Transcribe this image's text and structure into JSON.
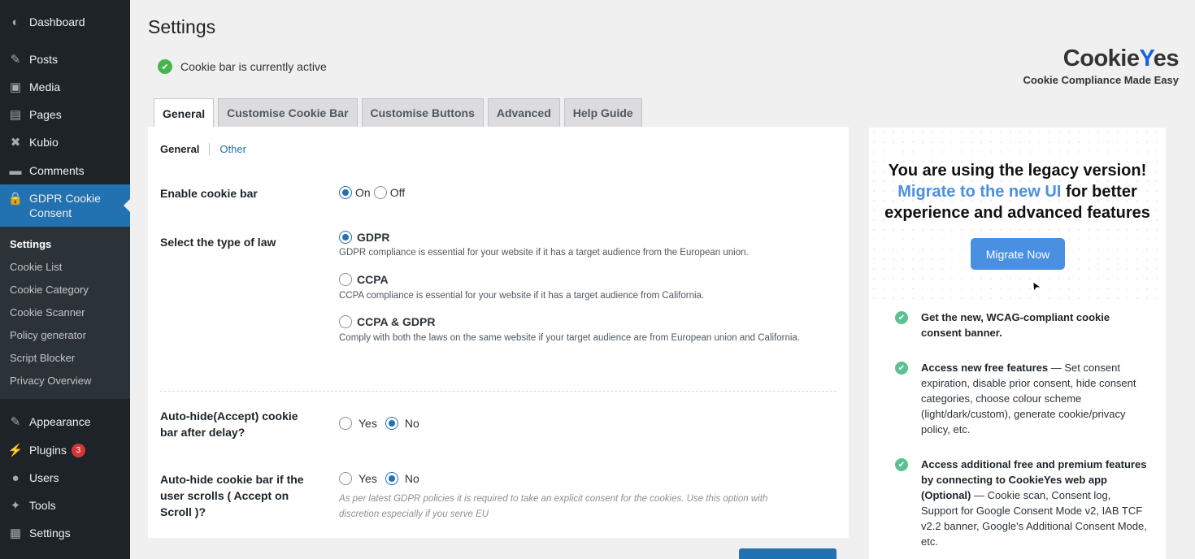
{
  "sidebar": {
    "menu": [
      {
        "label": "Dashboard",
        "icon": "dashboard-icon",
        "glyph": "◐"
      },
      {
        "label": "Posts",
        "icon": "pin-icon",
        "glyph": "✎"
      },
      {
        "label": "Media",
        "icon": "media-icon",
        "glyph": "▣"
      },
      {
        "label": "Pages",
        "icon": "pages-icon",
        "glyph": "▤"
      },
      {
        "label": "Kubio",
        "icon": "kubio-icon",
        "glyph": "✖"
      },
      {
        "label": "Comments",
        "icon": "comments-icon",
        "glyph": "▬"
      },
      {
        "label": "GDPR Cookie Consent",
        "icon": "lock-icon",
        "glyph": "🔒"
      },
      {
        "label": "Appearance",
        "icon": "brush-icon",
        "glyph": "✎"
      },
      {
        "label": "Plugins",
        "icon": "plugins-icon",
        "glyph": "⚡"
      },
      {
        "label": "Users",
        "icon": "user-icon",
        "glyph": "●"
      },
      {
        "label": "Tools",
        "icon": "wrench-icon",
        "glyph": "✦"
      },
      {
        "label": "Settings",
        "icon": "settings-icon",
        "glyph": "▦"
      }
    ],
    "plugins_badge": "3",
    "submenu": [
      "Settings",
      "Cookie List",
      "Cookie Category",
      "Cookie Scanner",
      "Policy generator",
      "Script Blocker",
      "Privacy Overview"
    ]
  },
  "page": {
    "title": "Settings",
    "status": "Cookie bar is currently active"
  },
  "logo": {
    "brand_a": "Cookie",
    "brand_y": "Y",
    "brand_b": "es",
    "tagline": "Cookie Compliance Made Easy"
  },
  "tabs": [
    "General",
    "Customise Cookie Bar",
    "Customise Buttons",
    "Advanced",
    "Help Guide"
  ],
  "subtabs": {
    "general": "General",
    "other": "Other"
  },
  "form": {
    "enable_label": "Enable cookie bar",
    "enable_on": "On",
    "enable_off": "Off",
    "law_label": "Select the type of law",
    "gdpr": "GDPR",
    "gdpr_desc": "GDPR compliance is essential for your website if it has a target audience from the European union.",
    "ccpa": "CCPA",
    "ccpa_desc": "CCPA compliance is essential for your website if it has a target audience from California.",
    "both": "CCPA & GDPR",
    "both_desc": "Comply with both the laws on the same website if your target audience are from European union and California.",
    "autohide_label": "Auto-hide(Accept) cookie bar after delay?",
    "yes": "Yes",
    "no": "No",
    "scroll_label": "Auto-hide cookie bar if the user scrolls ( Accept on Scroll )?",
    "scroll_desc": "As per latest GDPR policies it is required to take an explicit consent for the cookies. Use this option with discretion especially if you serve EU"
  },
  "promo": {
    "line1": "You are using the legacy version!",
    "link": "Migrate to the new UI",
    "line2": " for better",
    "line3": "experience and advanced features",
    "button": "Migrate Now",
    "f1_bold": "Get the new, WCAG-compliant cookie consent banner.",
    "f2_bold": "Access new free features",
    "f2_rest": " — Set consent expiration, disable prior consent, hide consent categories, choose colour scheme (light/dark/custom), generate cookie/privacy policy, etc.",
    "f3_bold": "Access additional free and premium features by connecting to CookieYes web app (Optional)",
    "f3_rest": " — Cookie scan, Consent log, Support for Google Consent Mode v2, IAB TCF v2.2 banner, Google's Additional Consent Mode, etc."
  },
  "colors": {
    "accent": "#2271b1",
    "sidebar": "#1d2327",
    "promo_blue": "#4a90e2",
    "check_green": "#46b450"
  }
}
